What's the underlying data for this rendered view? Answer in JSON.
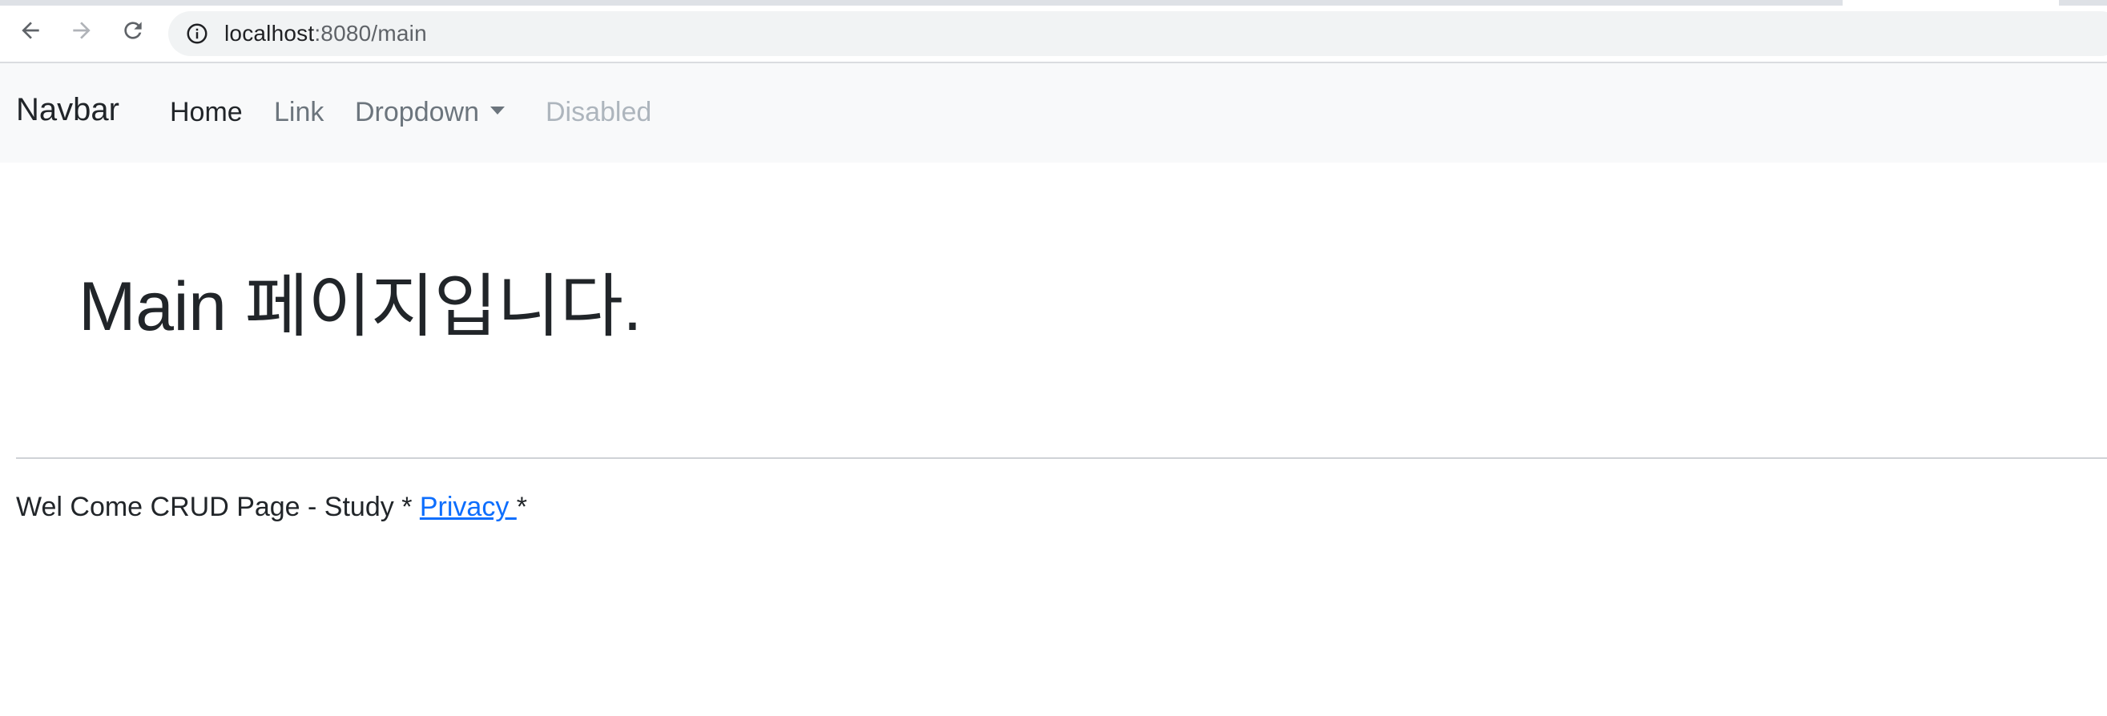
{
  "browser": {
    "url_host": "localhost",
    "url_rest": ":8080/main",
    "icons": {
      "back": "arrow-left-icon",
      "forward": "arrow-right-icon",
      "reload": "reload-icon",
      "site_info": "info-icon"
    }
  },
  "navbar": {
    "brand": "Navbar",
    "items": [
      {
        "label": "Home",
        "state": "active"
      },
      {
        "label": "Link",
        "state": "normal"
      },
      {
        "label": "Dropdown",
        "state": "dropdown"
      },
      {
        "label": "Disabled",
        "state": "disabled"
      }
    ]
  },
  "main": {
    "title": "Main 페이지입니다."
  },
  "footer": {
    "text_before": "Wel Come CRUD Page - Study * ",
    "link_label": "Privacy ",
    "text_after": "*"
  },
  "colors": {
    "navbar_bg": "#f8f9fa",
    "link_blue": "#0d6efd",
    "muted": "#6c757d",
    "disabled": "#adb5bd",
    "text": "#212529"
  }
}
